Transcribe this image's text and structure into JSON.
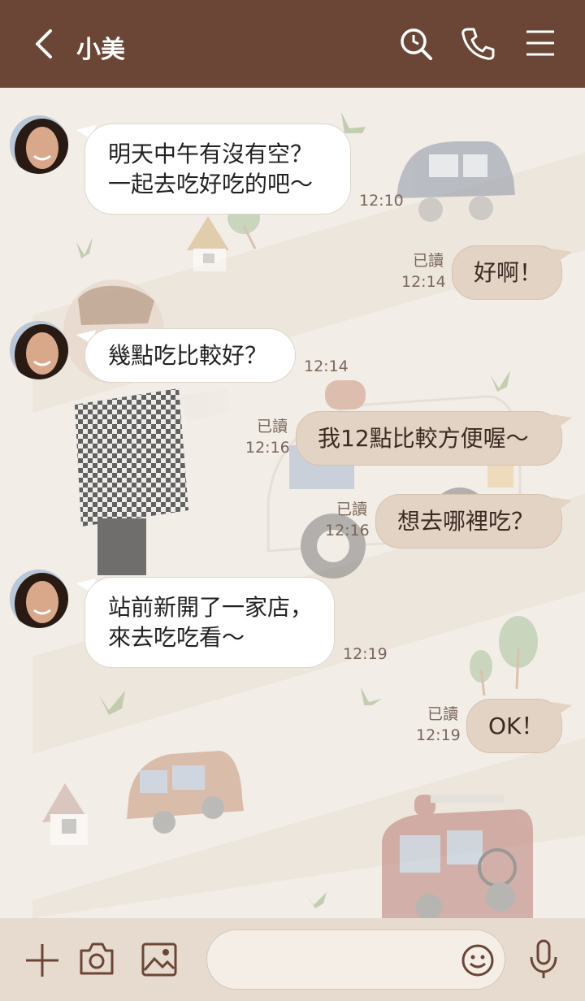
{
  "header": {
    "contact_name": "小美"
  },
  "messages": [
    {
      "side": "in",
      "text": "明天中午有沒有空？\n一起去吃好吃的吧～",
      "time": "12:10"
    },
    {
      "side": "out",
      "text": "好啊！",
      "read": "已讀",
      "time": "12:14"
    },
    {
      "side": "in",
      "text": "幾點吃比較好？",
      "time": "12:14"
    },
    {
      "side": "out",
      "text": "我12點比較方便喔～",
      "read": "已讀",
      "time": "12:16"
    },
    {
      "side": "out",
      "text": "想去哪裡吃？",
      "read": "已讀",
      "time": "12:16"
    },
    {
      "side": "in",
      "text": "站前新開了一家店，\n來去吃吃看～",
      "time": "12:19"
    },
    {
      "side": "out",
      "text": "OK！",
      "read": "已讀",
      "time": "12:19"
    }
  ],
  "input": {
    "placeholder": ""
  },
  "icons": {
    "back": "chevron-left-icon",
    "search": "search-icon",
    "call": "phone-icon",
    "menu": "menu-icon",
    "plus": "plus-icon",
    "camera": "camera-icon",
    "image": "image-icon",
    "emoji": "smiley-icon",
    "mic": "microphone-icon"
  },
  "colors": {
    "header": "#6b4535",
    "outgoing_bubble": "#e2d3c4",
    "incoming_bubble": "#ffffff",
    "background": "#f2ede7"
  }
}
